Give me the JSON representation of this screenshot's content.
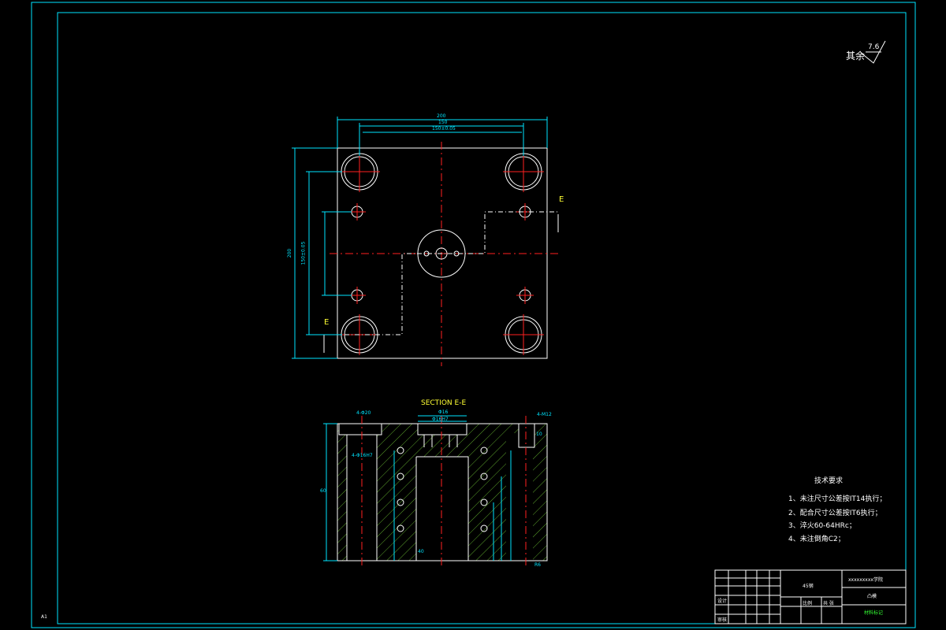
{
  "roughness": {
    "label": "其余",
    "value": "7.6"
  },
  "section_title": "SECTION E-E",
  "section_marker": "E",
  "plan_dims": {
    "overall_width": "200",
    "hole_span": "150",
    "hole_span_tol": "150±0.05",
    "overall_height": "200",
    "hole_span_v": "150±0.05"
  },
  "section_dims": {
    "bore_top": "Φ16",
    "bore_tol": "Φ16H7",
    "left_hole": "4-Φ20",
    "left_hole_2": "4-Φ16H7",
    "right_hole": "4-M12",
    "height": "60",
    "depth": "40",
    "right_small": "10",
    "bottom_r": "R6"
  },
  "tech_requirements": {
    "title": "技术要求",
    "items": [
      "1、未注尺寸公差按IT14执行；",
      "2、配合尺寸公差按IT6执行；",
      "3、淬火60-64HRc；",
      "4、未注倒角C2；"
    ]
  },
  "title_block": {
    "school": "xxxxxxxxx学院",
    "part_name": "凸模",
    "material": "45钢",
    "drawing_no": "A1",
    "scale_label": "比例",
    "sheet_label": "共 张",
    "design": "设计",
    "check": "审核",
    "green_note": "材料标记"
  },
  "sheet_size": "A1",
  "colors": {
    "frame": "#00e5ff",
    "outline": "#ffffff",
    "center": "#ff2020",
    "hatch": "#5aa02a",
    "dimension": "#00e5ff",
    "text": "#ffff33"
  }
}
